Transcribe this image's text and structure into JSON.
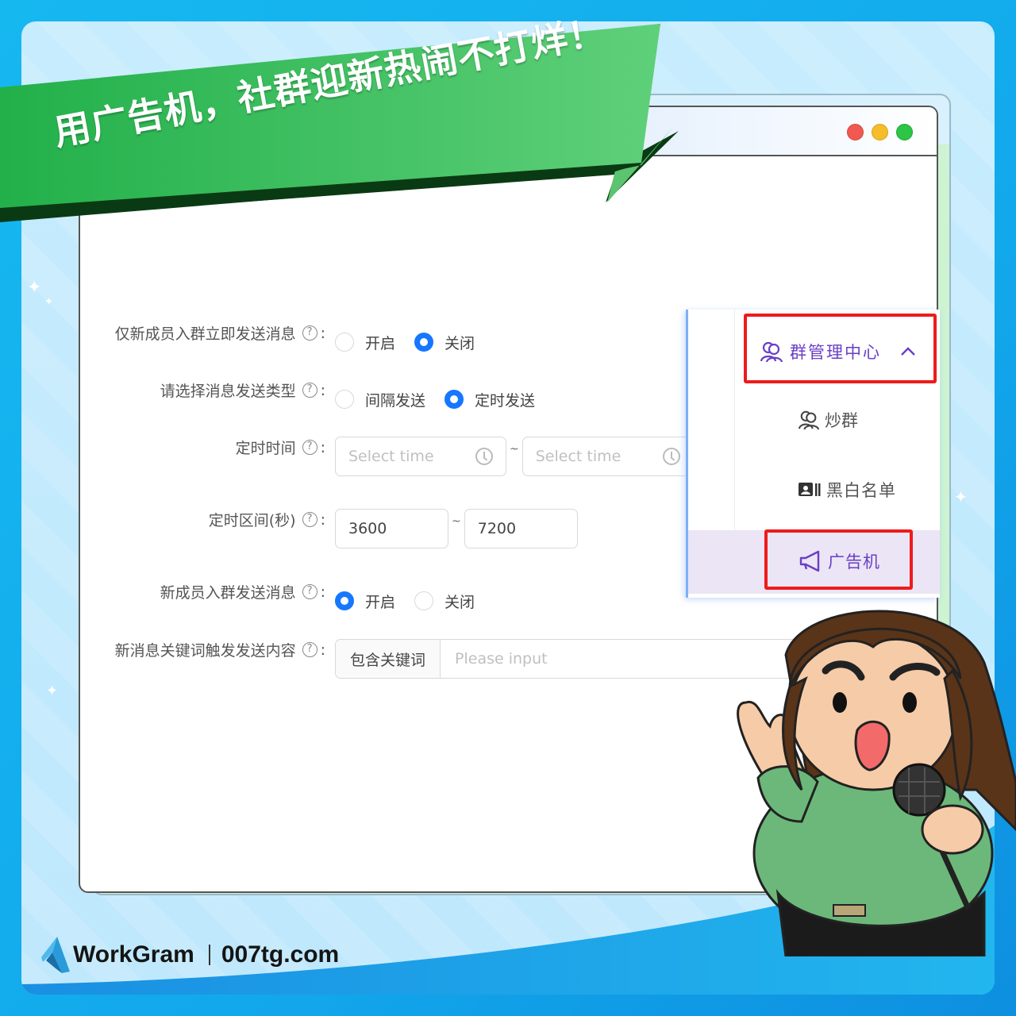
{
  "banner": {
    "headline": "用广告机，社群迎新热闹不打烊！"
  },
  "window": {
    "controls": [
      "close",
      "minimize",
      "maximize"
    ]
  },
  "form": {
    "rows": [
      {
        "label": "仅新成员入群立即发送消息",
        "help_icon": "question-circle-icon",
        "type": "radio",
        "options": [
          {
            "label": "开启",
            "checked": false
          },
          {
            "label": "关闭",
            "checked": true
          }
        ]
      },
      {
        "label": "请选择消息发送类型",
        "help_icon": "question-circle-icon",
        "type": "radio",
        "options": [
          {
            "label": "间隔发送",
            "checked": false
          },
          {
            "label": "定时发送",
            "checked": true
          }
        ]
      },
      {
        "label": "定时时间",
        "help_icon": "question-circle-icon",
        "type": "time-range",
        "start": {
          "value": "",
          "placeholder": "Select time",
          "icon": "clock-icon"
        },
        "separator": "~",
        "end": {
          "value": "",
          "placeholder": "Select time",
          "icon": "clock-icon"
        }
      },
      {
        "label": "定时区间(秒)",
        "help_icon": "question-circle-icon",
        "type": "number-range",
        "start": {
          "value": "3600"
        },
        "separator": "~",
        "end": {
          "value": "7200"
        }
      },
      {
        "label": "新成员入群发送消息",
        "help_icon": "question-circle-icon",
        "type": "radio",
        "options": [
          {
            "label": "开启",
            "checked": true
          },
          {
            "label": "关闭",
            "checked": false
          }
        ]
      },
      {
        "label": "新消息关键词触发发送内容",
        "help_icon": "question-circle-icon",
        "type": "addon-input",
        "addon": "包含关键词",
        "value": "",
        "placeholder": "Please input"
      }
    ],
    "help_glyph": "?",
    "colon": ":"
  },
  "sidebar": {
    "group": {
      "label": "群管理中心",
      "icon": "users-icon",
      "expanded": true,
      "highlighted": true
    },
    "items": [
      {
        "label": "炒群",
        "icon": "users-icon",
        "active": false
      },
      {
        "label": "黑白名单",
        "icon": "contact-card-icon",
        "active": false
      },
      {
        "label": "广告机",
        "icon": "megaphone-icon",
        "active": true,
        "highlighted": true
      }
    ]
  },
  "footer": {
    "brand": "WorkGram",
    "site": "007tg.com"
  },
  "colors": {
    "primary": "#1677ff",
    "menu_accent": "#6a3fc4",
    "highlight_box": "#ee1b1b",
    "banner_green": "#3cc35f"
  }
}
